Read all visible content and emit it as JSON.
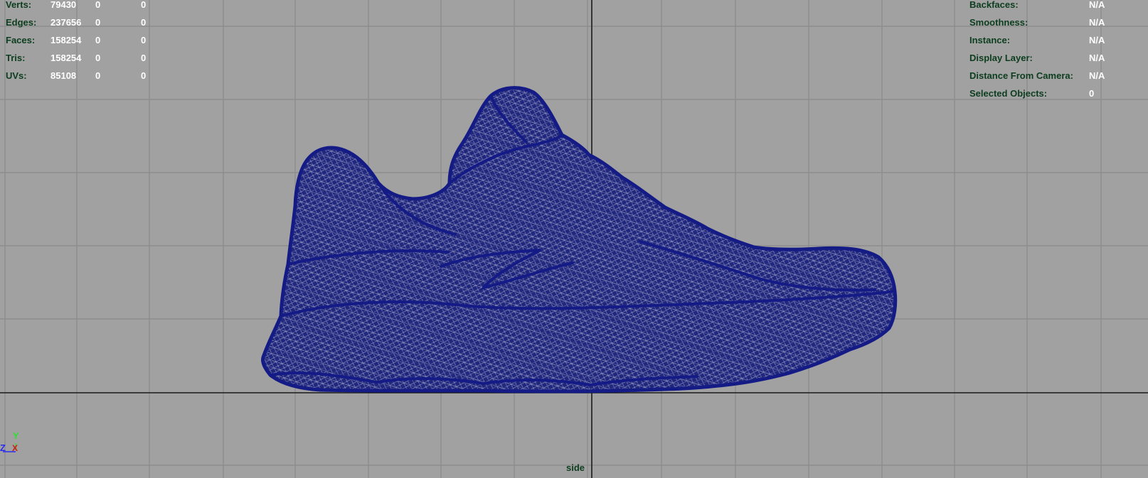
{
  "viewport": {
    "camera_name": "side",
    "background_color": "#a1a1a1",
    "grid_color": "#8a8a8a",
    "axis_line_color": "#1a1a1a",
    "wireframe_color": "#141b86"
  },
  "hud_left": {
    "rows": [
      {
        "label": "Verts:",
        "v1": "79430",
        "v2": "0",
        "v3": "0"
      },
      {
        "label": "Edges:",
        "v1": "237656",
        "v2": "0",
        "v3": "0"
      },
      {
        "label": "Faces:",
        "v1": "158254",
        "v2": "0",
        "v3": "0"
      },
      {
        "label": "Tris:",
        "v1": "158254",
        "v2": "0",
        "v3": "0"
      },
      {
        "label": "UVs:",
        "v1": "85108",
        "v2": "0",
        "v3": "0"
      }
    ]
  },
  "hud_right": {
    "rows": [
      {
        "label": "Backfaces:",
        "value": "N/A"
      },
      {
        "label": "Smoothness:",
        "value": "N/A"
      },
      {
        "label": "Instance:",
        "value": "N/A"
      },
      {
        "label": "Display Layer:",
        "value": "N/A"
      },
      {
        "label": "Distance From Camera:",
        "value": "N/A"
      },
      {
        "label": "Selected Objects:",
        "value": "0"
      }
    ]
  },
  "axis_gizmo": {
    "y_label": "Y",
    "z_label": "Z",
    "x_label": "X",
    "y_color": "#2fe02f",
    "z_color": "#2a2af0",
    "x_color": "#d01818"
  },
  "model": {
    "icon": "sneaker-wireframe-icon"
  }
}
